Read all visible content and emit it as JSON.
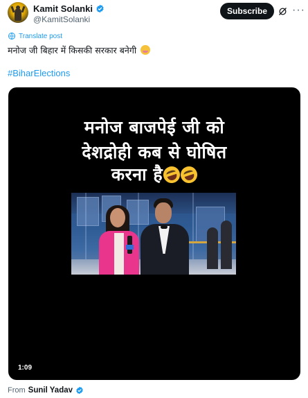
{
  "author": {
    "display_name": "Kamit Solanki",
    "handle": "@KamitSolanki",
    "verified": true
  },
  "actions": {
    "subscribe_label": "Subscribe"
  },
  "post": {
    "translate_label": "Translate post",
    "text": "मनोज जी बिहार में किसकी सरकार बनेगी",
    "hashtag": "#BiharElections"
  },
  "video": {
    "caption_lines": [
      "मनोज बाजपेई  जी को",
      "देशद्रोही कब से घोषित",
      "करना है"
    ],
    "duration": "1:09"
  },
  "attribution": {
    "prefix": "From",
    "source_name": "Sunil Yadav",
    "verified": true
  },
  "colors": {
    "accent_blue": "#1d9bf0",
    "text_primary": "#0f1419",
    "text_secondary": "#536471",
    "button_dark": "#0f1419"
  }
}
